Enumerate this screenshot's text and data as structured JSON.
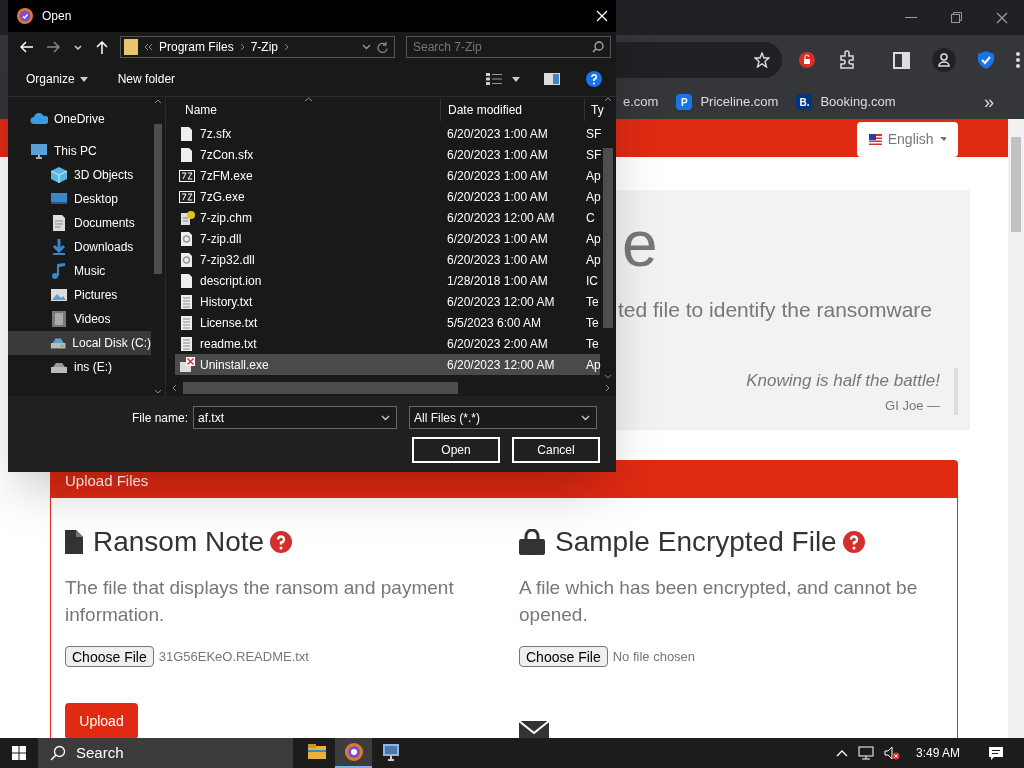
{
  "browser": {
    "bookmarks": [
      {
        "label": "e.com"
      },
      {
        "label": "Priceline.com",
        "letter": "P",
        "color": "#1a73e8"
      },
      {
        "label": "Booking.com",
        "letter": "B.",
        "color": "#003580"
      }
    ],
    "bookmarks_overflow": "»"
  },
  "page": {
    "language": "English",
    "hero": {
      "heading": "e",
      "subtitle": "ted file to identify the ransomware",
      "quote": "Knowing is half the battle!",
      "attribution": "GI Joe —"
    },
    "upload": {
      "title": "Upload Files",
      "sections": [
        {
          "kind": "file",
          "title": "Ransom Note",
          "description": "The file that displays the ransom and payment information.",
          "button": "Choose File",
          "file": "31G56EKeO.README.txt"
        },
        {
          "kind": "lock",
          "title": "Sample Encrypted File",
          "description": "A file which has been encrypted, and cannot be opened.",
          "button": "Choose File",
          "file": "No file chosen"
        }
      ],
      "upload_button": "Upload"
    }
  },
  "dialog": {
    "title": "Open",
    "breadcrumb": [
      "Program Files",
      "7-Zip"
    ],
    "search": {
      "placeholder": "Search 7-Zip"
    },
    "organize": "Organize",
    "new_folder": "New folder",
    "sidebar": [
      {
        "label": "OneDrive",
        "kind": "cloud",
        "selected": false
      },
      {
        "label": "This PC",
        "kind": "pc",
        "selected": false,
        "children": [
          {
            "label": "3D Objects",
            "kind": "cube",
            "selected": false
          },
          {
            "label": "Desktop",
            "kind": "desktop",
            "selected": false
          },
          {
            "label": "Documents",
            "kind": "documents",
            "selected": false
          },
          {
            "label": "Downloads",
            "kind": "downloads",
            "selected": false
          },
          {
            "label": "Music",
            "kind": "music",
            "selected": false
          },
          {
            "label": "Pictures",
            "kind": "pictures",
            "selected": false
          },
          {
            "label": "Videos",
            "kind": "videos",
            "selected": false
          },
          {
            "label": "Local Disk (C:)",
            "kind": "disk",
            "selected": true
          },
          {
            "label": "ins (E:)",
            "kind": "drive",
            "selected": false
          }
        ]
      }
    ],
    "columns": [
      "Name",
      "Date modified",
      "Ty"
    ],
    "files": [
      {
        "name": "7z.sfx",
        "date": "6/20/2023 1:00 AM",
        "type": "SF",
        "kind": "blank",
        "selected": false
      },
      {
        "name": "7zCon.sfx",
        "date": "6/20/2023 1:00 AM",
        "type": "SF",
        "kind": "blank",
        "selected": false
      },
      {
        "name": "7zFM.exe",
        "date": "6/20/2023 1:00 AM",
        "type": "Ap",
        "kind": "app",
        "selected": false
      },
      {
        "name": "7zG.exe",
        "date": "6/20/2023 1:00 AM",
        "type": "Ap",
        "kind": "app",
        "selected": false
      },
      {
        "name": "7-zip.chm",
        "date": "6/20/2023 12:00 AM",
        "type": "C",
        "kind": "help",
        "selected": false
      },
      {
        "name": "7-zip.dll",
        "date": "6/20/2023 1:00 AM",
        "type": "Ap",
        "kind": "dll",
        "selected": false
      },
      {
        "name": "7-zip32.dll",
        "date": "6/20/2023 1:00 AM",
        "type": "Ap",
        "kind": "dll",
        "selected": false
      },
      {
        "name": "descript.ion",
        "date": "1/28/2018 1:00 AM",
        "type": "IC",
        "kind": "blank",
        "selected": false
      },
      {
        "name": "History.txt",
        "date": "6/20/2023 12:00 AM",
        "type": "Te",
        "kind": "text",
        "selected": false
      },
      {
        "name": "License.txt",
        "date": "5/5/2023 6:00 AM",
        "type": "Te",
        "kind": "text",
        "selected": false
      },
      {
        "name": "readme.txt",
        "date": "6/20/2023 2:00 AM",
        "type": "Te",
        "kind": "text",
        "selected": false
      },
      {
        "name": "Uninstall.exe",
        "date": "6/20/2023 12:00 AM",
        "type": "Ap",
        "kind": "uninstall",
        "selected": true
      }
    ],
    "file_name_label": "File name:",
    "file_name": "af.txt",
    "filter": "All Files (*.*)",
    "buttons": [
      "Open",
      "Cancel"
    ]
  },
  "taskbar": {
    "search": {
      "placeholder": "Search"
    },
    "apps": [
      {
        "kind": "folder",
        "selected": false
      },
      {
        "kind": "browser",
        "selected": true
      },
      {
        "kind": "monitor",
        "selected": false
      }
    ],
    "time": "3:49 AM"
  }
}
